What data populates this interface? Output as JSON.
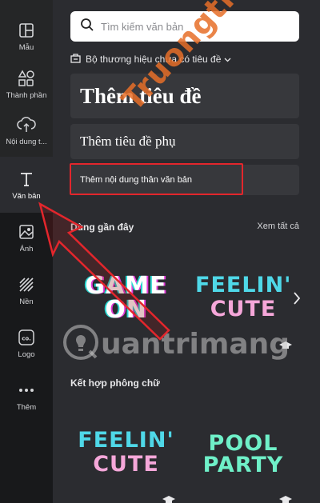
{
  "sidebar": {
    "items": [
      {
        "label": "Mẫu",
        "icon": "template-icon"
      },
      {
        "label": "Thành phần",
        "icon": "elements-icon"
      },
      {
        "label": "Nội dung t...",
        "icon": "upload-icon"
      },
      {
        "label": "Văn bản",
        "icon": "text-icon"
      },
      {
        "label": "Ảnh",
        "icon": "photo-icon"
      },
      {
        "label": "Nền",
        "icon": "background-icon"
      },
      {
        "label": "Logo",
        "icon": "logo-icon"
      },
      {
        "label": "Thêm",
        "icon": "more-icon"
      }
    ]
  },
  "search": {
    "placeholder": "Tìm kiếm văn bản"
  },
  "brand": {
    "label": "Bộ thương hiệu chưa có tiêu đề"
  },
  "text_buttons": {
    "heading": "Thêm tiêu đề",
    "subheading": "Thêm tiêu đề phụ",
    "body": "Thêm nội dung thân văn bản"
  },
  "recent": {
    "title": "Dùng gần đây",
    "see_all": "Xem tất cả",
    "samples": [
      {
        "line1": "GAME",
        "line2": "ON"
      },
      {
        "line1": "FEELIN'",
        "line2": "CUTE"
      }
    ]
  },
  "font_combos": {
    "title": "Kết hợp phông chữ",
    "samples": [
      {
        "line1": "FEELIN'",
        "line2": "CUTE"
      },
      {
        "line1": "POOL",
        "line2": "PARTY"
      }
    ]
  },
  "watermarks": {
    "top": "Truongthi.top",
    "mid": "uantrimang"
  },
  "colors": {
    "sidebar_bg": "#18191b",
    "panel_bg": "#2b2c30",
    "button_bg": "#37383c",
    "highlight_red": "#e3262c"
  }
}
